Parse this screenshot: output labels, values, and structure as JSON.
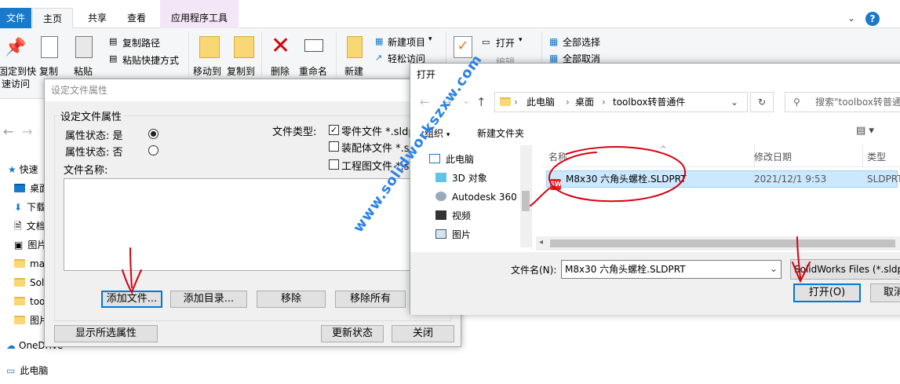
{
  "ribbon": {
    "context_group_label": "",
    "tabs": [
      {
        "label": "文件"
      },
      {
        "label": "主页"
      },
      {
        "label": "共享"
      },
      {
        "label": "查看"
      },
      {
        "label": "应用程序工具"
      }
    ],
    "left_partial_1": "固定到快",
    "left_partial_2": "速访问",
    "copy": "复制",
    "paste": "粘贴",
    "copy_path": "复制路径",
    "paste_shortcut": "粘贴快捷方式",
    "move_to": "移动到",
    "copy_to": "复制到",
    "delete": "删除",
    "rename": "重命名",
    "new_folder": "新建",
    "new_item": "新建项目",
    "easy_access": "轻松访问",
    "open": "打开",
    "edit_partial": "编辑",
    "select_all": "全部选择",
    "select_none": "全部取消"
  },
  "nav": {
    "quick_access": "快速",
    "items": [
      "桌面",
      "下载",
      "文档",
      "图片",
      "ma",
      "Sol",
      "too",
      "图片"
    ],
    "onedrive": "OneDrive",
    "this_pc": "此电脑"
  },
  "props": {
    "title": "设定文件属性",
    "group_label": "设定文件属性",
    "attr_yes": "属性状态: 是",
    "attr_no": "属性状态: 否",
    "file_type_label": "文件类型:",
    "part_files": "零件文件 *.sldprt",
    "assembly_files": "装配体文件 *.sldasm",
    "drawing_files": "工程图文件 *.slddrw",
    "file_name_label": "文件名称:",
    "add_file": "添加文件...",
    "add_dir": "添加目录...",
    "remove": "移除",
    "remove_all": "移除所有",
    "show_selected": "显示所选属性",
    "update_status": "更新状态",
    "close": "关闭"
  },
  "open": {
    "title": "打开",
    "breadcrumb": [
      "此电脑",
      "桌面",
      "toolbox转普通件"
    ],
    "search_placeholder": "搜索\"toolbox转普通件\"",
    "organize": "组织",
    "new_folder": "新建文件夹",
    "tree": [
      "此电脑",
      "3D 对象",
      "Autodesk 360",
      "视频",
      "图片"
    ],
    "columns": {
      "name": "名称",
      "modified": "修改日期",
      "type": "类型"
    },
    "file": {
      "name": "M8x30 六角头螺栓.SLDPRT",
      "modified": "2021/12/1 9:53",
      "type": "SLDPRT"
    },
    "filename_label": "文件名(N):",
    "filename_value": "M8x30 六角头螺栓.SLDPRT",
    "filetype_value": "SolidWorks Files (*.sldprt)",
    "open_button": "打开(O)",
    "cancel_button": "取消"
  },
  "watermark": "www.solidworkszxw.com",
  "colors": {
    "accent": "#1979ca",
    "selection": "#cce8ff",
    "annotation": "#d6000f",
    "watermark": "#2a82e4"
  }
}
